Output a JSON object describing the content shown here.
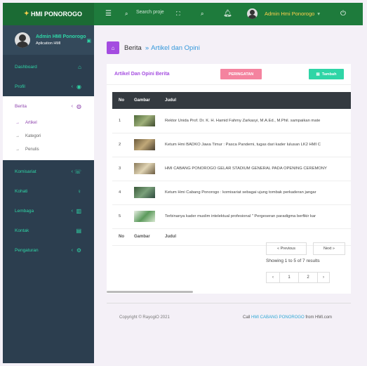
{
  "header": {
    "brand": "HMI PONOROGO",
    "search_placeholder": "Search proje",
    "user_name": "Admin Hmi Ponorogo"
  },
  "sidebar": {
    "profile_name": "Admin HMI Ponorogo",
    "profile_role": "Aplication HMI",
    "items": [
      {
        "label": "Dashboard"
      },
      {
        "label": "Profil"
      },
      {
        "label": "Berita"
      },
      {
        "label": "Komisariat"
      },
      {
        "label": "Kohati"
      },
      {
        "label": "Lembaga"
      },
      {
        "label": "Kontak"
      },
      {
        "label": "Pengaturan"
      }
    ],
    "submenu": [
      "Artikel",
      "Kategori",
      "Penulis"
    ]
  },
  "breadcrumb": {
    "parent": "Berita",
    "separator": "»",
    "current": "Artikel dan Opini"
  },
  "card": {
    "title": "Artikel Dan Opini Berita",
    "warning_button": "PERINGATAN",
    "add_button": "Tambah"
  },
  "table": {
    "headers": [
      "No",
      "Gambar",
      "Judul"
    ],
    "rows": [
      {
        "no": "1",
        "title": "Rektor Unida Prof. Dr. K. H. Hamid Fahmy Zarkasyi, M.A.Ed., M.Phil. sampaikan mate"
      },
      {
        "no": "2",
        "title": "Ketum Hmi BADKO Jawa Timur : Pasca Pandemi, tugas dari kader lulusan LK2 HMI C"
      },
      {
        "no": "3",
        "title": "HMI CABANG PONOROGO GELAR STADIUM GENERAL PADA OPENING CEREMONY"
      },
      {
        "no": "4",
        "title": "Ketum Hmi Cabang Ponorogo : komisariat sebagai ujung tombak perkaderan jangar"
      },
      {
        "no": "5",
        "title": "Terbinanya kader muslim intelektual profesional \" Pergeseran paradigma berfikir kar"
      }
    ]
  },
  "pagination": {
    "prev": "« Previous",
    "next": "Next »",
    "info": "Showing 1 to 5 of 7 results",
    "prev_arrow": "‹",
    "page1": "1",
    "page2": "2",
    "next_arrow": "›"
  },
  "footer": {
    "copyright": "Copyright © RayogiO 2021",
    "call_prefix": "Call",
    "call_link": "HMI CABANG PONOROGO",
    "call_suffix": "from HMI.com"
  },
  "colors": {
    "accent": "#a44ce0",
    "green": "#1e7b3c",
    "teal": "#2fd5a6",
    "sidebar": "#2c3e4f",
    "pink": "#f4839f"
  }
}
